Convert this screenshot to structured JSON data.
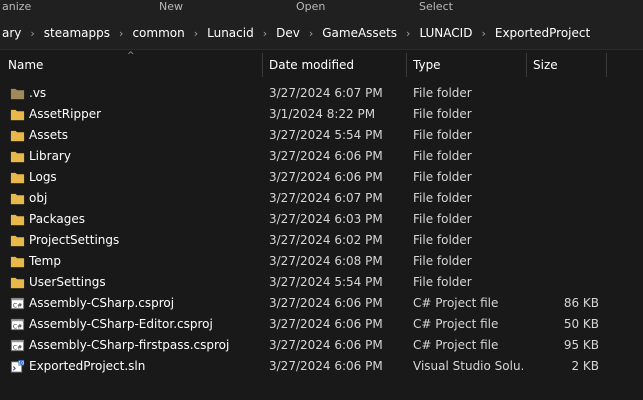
{
  "ribbon": {
    "organize": "anize",
    "new": "New",
    "open": "Open",
    "select": "Select"
  },
  "breadcrumb": [
    "ary",
    "steamapps",
    "common",
    "Lunacid",
    "Dev",
    "GameAssets",
    "LUNACID",
    "ExportedProject"
  ],
  "columns": {
    "name": "Name",
    "date": "Date modified",
    "type": "Type",
    "size": "Size"
  },
  "files": [
    {
      "name": ".vs",
      "date": "3/27/2024 6:07 PM",
      "type": "File folder",
      "size": "",
      "icon": "folder-hidden-icon"
    },
    {
      "name": "AssetRipper",
      "date": "3/1/2024 8:22 PM",
      "type": "File folder",
      "size": "",
      "icon": "folder-icon"
    },
    {
      "name": "Assets",
      "date": "3/27/2024 5:54 PM",
      "type": "File folder",
      "size": "",
      "icon": "folder-icon"
    },
    {
      "name": "Library",
      "date": "3/27/2024 6:06 PM",
      "type": "File folder",
      "size": "",
      "icon": "folder-icon"
    },
    {
      "name": "Logs",
      "date": "3/27/2024 6:06 PM",
      "type": "File folder",
      "size": "",
      "icon": "folder-icon"
    },
    {
      "name": "obj",
      "date": "3/27/2024 6:07 PM",
      "type": "File folder",
      "size": "",
      "icon": "folder-icon"
    },
    {
      "name": "Packages",
      "date": "3/27/2024 6:03 PM",
      "type": "File folder",
      "size": "",
      "icon": "folder-icon"
    },
    {
      "name": "ProjectSettings",
      "date": "3/27/2024 6:02 PM",
      "type": "File folder",
      "size": "",
      "icon": "folder-icon"
    },
    {
      "name": "Temp",
      "date": "3/27/2024 6:08 PM",
      "type": "File folder",
      "size": "",
      "icon": "folder-icon"
    },
    {
      "name": "UserSettings",
      "date": "3/27/2024 5:54 PM",
      "type": "File folder",
      "size": "",
      "icon": "folder-icon"
    },
    {
      "name": "Assembly-CSharp.csproj",
      "date": "3/27/2024 6:06 PM",
      "type": "C# Project file",
      "size": "86 KB",
      "icon": "csproj-file-icon"
    },
    {
      "name": "Assembly-CSharp-Editor.csproj",
      "date": "3/27/2024 6:06 PM",
      "type": "C# Project file",
      "size": "50 KB",
      "icon": "csproj-file-icon"
    },
    {
      "name": "Assembly-CSharp-firstpass.csproj",
      "date": "3/27/2024 6:06 PM",
      "type": "C# Project file",
      "size": "95 KB",
      "icon": "csproj-file-icon"
    },
    {
      "name": "ExportedProject.sln",
      "date": "3/27/2024 6:06 PM",
      "type": "Visual Studio Solu...",
      "size": "2 KB",
      "icon": "sln-file-icon"
    }
  ],
  "colors": {
    "folder": "#e8b84a",
    "folder_hidden": "#9e8a5a",
    "background": "#191919"
  }
}
